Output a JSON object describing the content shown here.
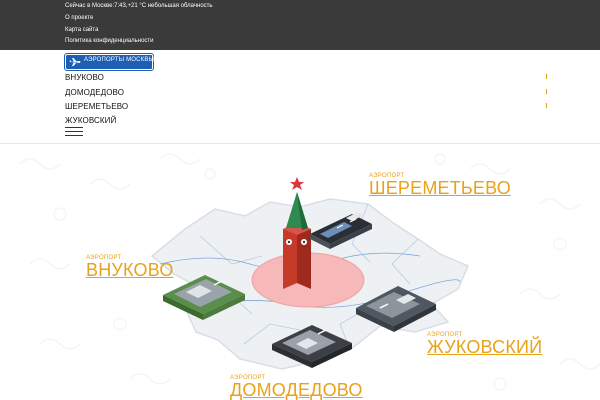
{
  "topbar": {
    "weather": "Сейчас в Москве:7:43,+21 °С небольшая облачность",
    "links": [
      "О проекте",
      "Карта сайта",
      "Политика конфиденциальности"
    ]
  },
  "logo": {
    "text": "АЭРОПОРТЫ МОСКВЫ",
    "icon": "airplane-icon"
  },
  "nav": {
    "items": [
      "ВНУКОВО",
      "ДОМОДЕДОВО",
      "ШЕРЕМЕТЬЕВО",
      "ЖУКОВСКИЙ"
    ],
    "menu_icon": "hamburger-icon"
  },
  "map": {
    "caption": "АЭРОПОРТ",
    "airports": {
      "sheremetyevo": "ШЕРЕМЕТЬЕВО",
      "vnukovo": "ВНУКОВО",
      "zhukovsky": "ЖУКОВСКИЙ",
      "domodedovo": "ДОМОДЕДОВО"
    }
  },
  "colors": {
    "topbar_bg": "#3a3a3a",
    "logo_blue": "#1f5fb3",
    "accent_orange": "#e8a21a",
    "kremlin_red": "#c63a2a",
    "moscow_pink": "#f6b8b8",
    "region_gray": "#eef1f4"
  }
}
